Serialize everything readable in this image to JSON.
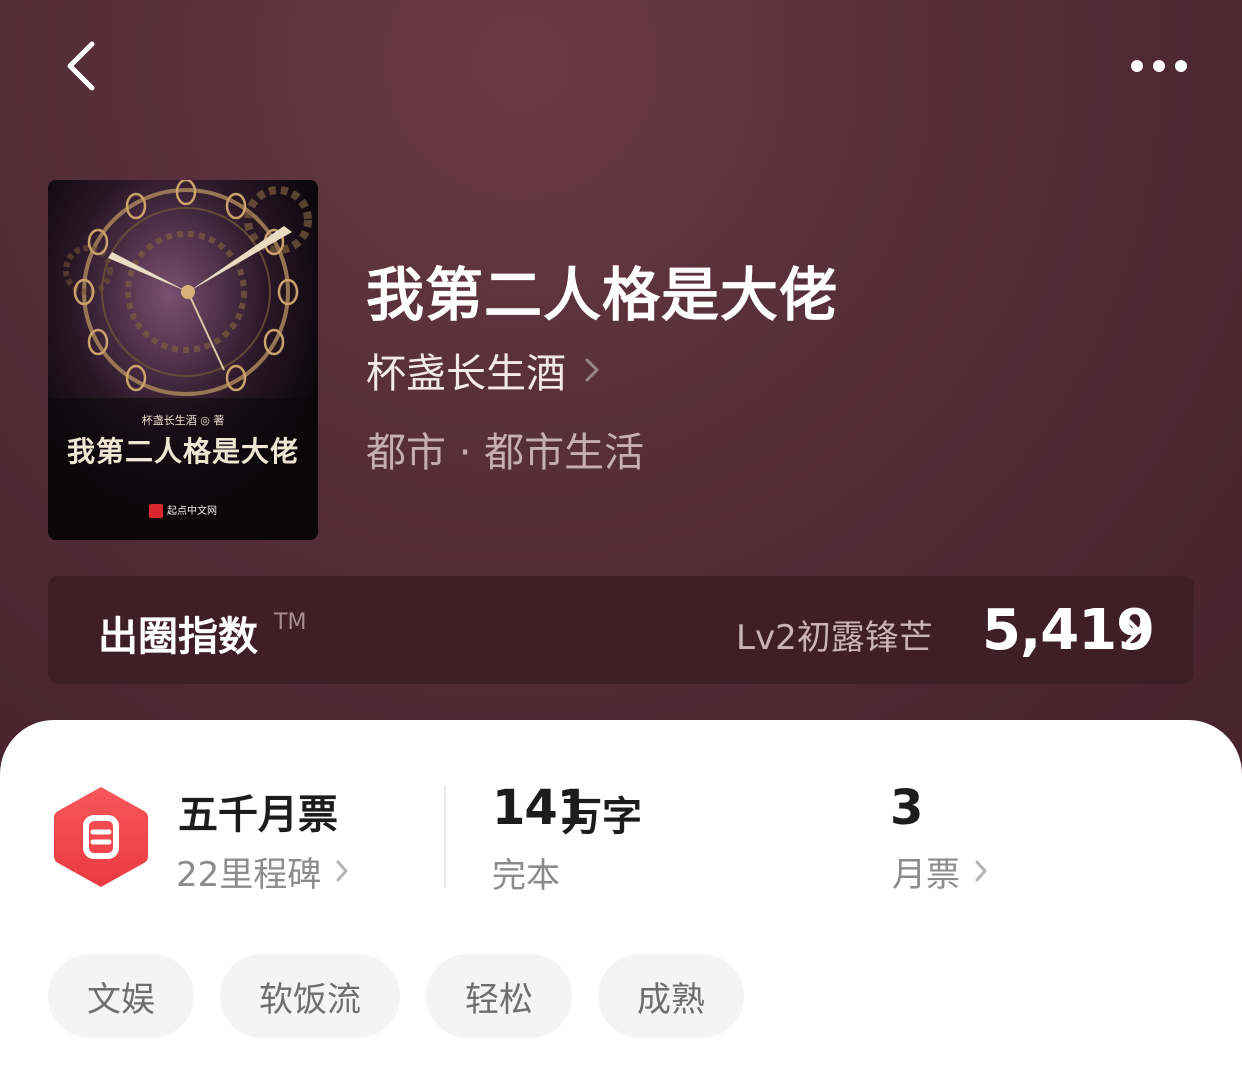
{
  "header": {
    "back_icon": "chevron-left-icon",
    "more_icon": "more-dots-icon"
  },
  "book": {
    "title": "我第二人格是大佬",
    "author": "杯盏长生酒",
    "genre": "都市 · 都市生活",
    "cover": {
      "author_line": "杯盏长生酒 ◎ 著",
      "title": "我第二人格是大佬",
      "publisher": "起点中文网"
    }
  },
  "breakout_index": {
    "label": "出圈指数",
    "tm": "TM",
    "level": "Lv2初露锋芒",
    "value": "5,419"
  },
  "stats": {
    "monthly_ticket_badge": {
      "title": "五千月票",
      "subtitle": "22里程碑",
      "icon": "ticket-badge-icon",
      "color": "#f0454b"
    },
    "word_count": {
      "number": "141",
      "unit": "万字",
      "subtitle": "完本"
    },
    "votes": {
      "number": "3",
      "subtitle": "月票"
    }
  },
  "tags": [
    "文娱",
    "软饭流",
    "轻松",
    "成熟"
  ],
  "colors": {
    "hero_bg": "#4e2833",
    "index_bar_bg": "#3e1f27",
    "accent_red": "#f0454b"
  }
}
